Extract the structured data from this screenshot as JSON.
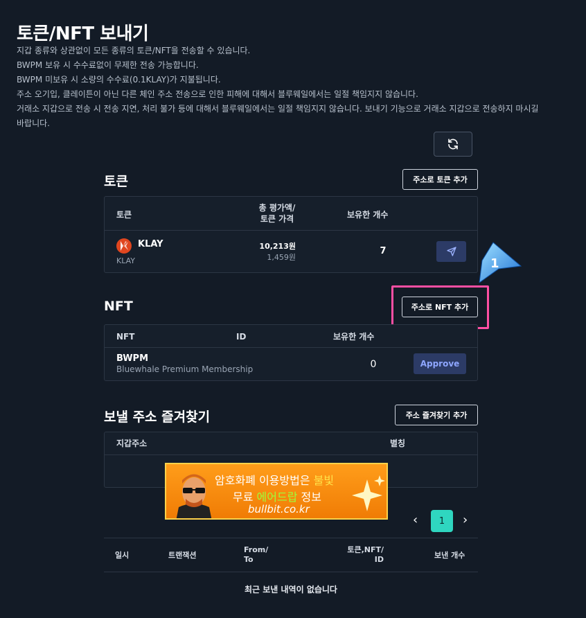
{
  "page": {
    "title": "토큰/NFT 보내기",
    "notices": [
      "지갑 종류와 상관없이 모든 종류의 토큰/NFT을 전송할 수 있습니다.",
      "BWPM 보유 시 수수료없이 무제한 전송 가능합니다.",
      "BWPM 미보유 시 소량의 수수료(0.1KLAY)가 지불됩니다.",
      "주소 오기입, 클레이튼이 아닌 다른 체인 주소 전송으로 인한 피해에 대해서 블루웨일에서는 일절 책임지지 않습니다.",
      "거래소 지갑으로 전송 시 전송 지연, 처리 불가 등에 대해서 블루웨일에서는 일절 책임지지 않습니다. 보내기 기능으로 거래소 지갑으로 전송하지 마시길",
      "바랍니다."
    ]
  },
  "token": {
    "title": "토큰",
    "add_button": "주소로 토큰 추가",
    "headers": {
      "token": "토큰",
      "value_line1": "총 평가액/",
      "value_line2": "토큰 가격",
      "holding": "보유한 개수"
    },
    "rows": [
      {
        "symbol": "KLAY",
        "name": "KLAY",
        "total_value": "10,213원",
        "price": "1,459원",
        "count": "7"
      }
    ]
  },
  "nft": {
    "title": "NFT",
    "add_button": "주소로 NFT 추가",
    "headers": {
      "nft": "NFT",
      "id": "ID",
      "holding": "보유한 개수"
    },
    "rows": [
      {
        "name": "BWPM",
        "fullname": "Bluewhale Premium Membership",
        "count": "0",
        "action": "Approve"
      }
    ]
  },
  "favorites": {
    "title": "보낼 주소 즐겨찾기",
    "add_button": "주소 즐겨찾기 추가",
    "headers": {
      "address": "지갑주소",
      "alias": "별칭"
    }
  },
  "pagination": {
    "current": "1",
    "prev": "‹",
    "next": "›"
  },
  "history": {
    "headers": {
      "date": "일시",
      "tx": "트랜잭션",
      "from_line1": "From/",
      "from_line2": "To",
      "token_line1": "토큰,NFT/",
      "token_line2": "ID",
      "count": "보낸 개수"
    },
    "empty": "최근 보낸 내역이 없습니다"
  },
  "annotation": {
    "step": "1"
  },
  "ad": {
    "line1_prefix": "암호화폐 이용방법은 ",
    "line1_highlight": "불빛",
    "line2_prefix": "무료 ",
    "line2_highlight": "에어드랍",
    "line2_suffix": " 정보",
    "url": "bullbit.co.kr"
  },
  "colors": {
    "background": "#131b26",
    "panel": "#161f2b",
    "accent_teal": "#2fd6c0",
    "highlight_pink": "#ff4fa3",
    "button_navy": "#2c3b66",
    "klay_red": "#e0461f",
    "ad_orange": "#f07c05"
  }
}
